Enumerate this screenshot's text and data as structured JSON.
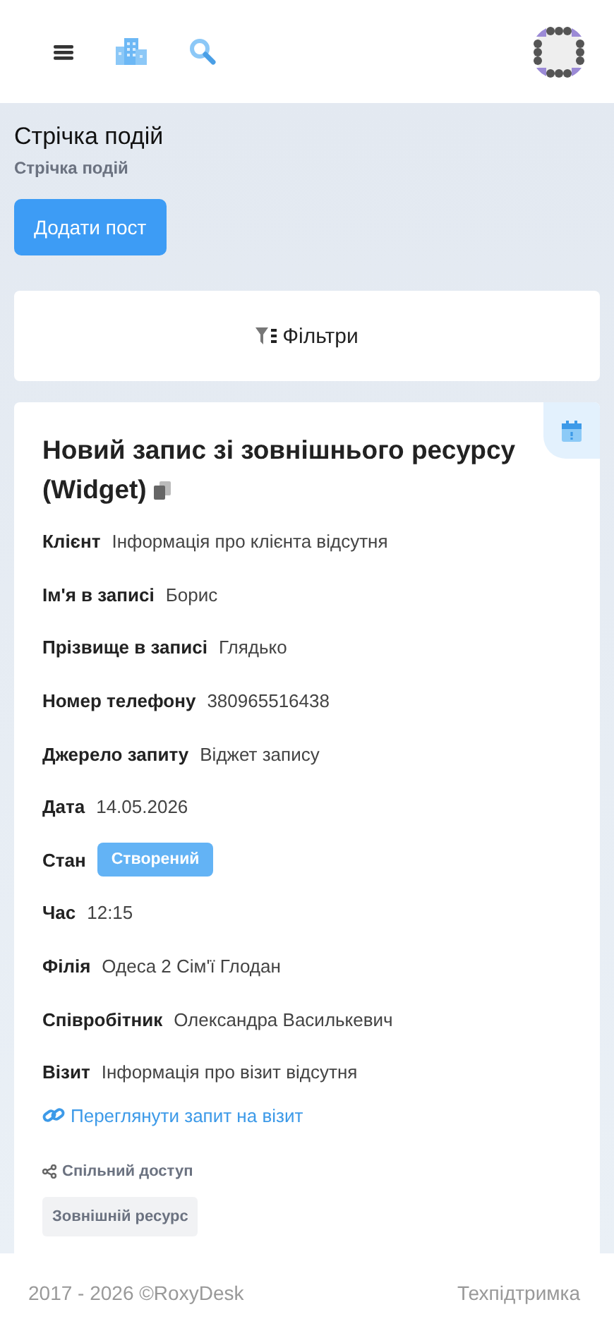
{
  "page_header": {
    "title": "Стрічка подій",
    "breadcrumb": "Стрічка подій"
  },
  "add_button": "Додати пост",
  "filters": {
    "label": "Фільтри"
  },
  "event": {
    "title": "Новий запис зі зовнішнього ресурсу (Widget)",
    "fields": [
      {
        "kind": "text",
        "label": "Клієнт",
        "value": "Інформація про клієнта відсутня"
      },
      {
        "kind": "text",
        "label": "Ім'я в записі",
        "value": "Борис"
      },
      {
        "kind": "text",
        "label": "Прізвище в записі",
        "value": "Глядько"
      },
      {
        "kind": "text",
        "label": "Номер телефону",
        "value": "380965516438"
      },
      {
        "kind": "text",
        "label": "Джерело запиту",
        "value": "Віджет запису"
      },
      {
        "kind": "text",
        "label": "Дата",
        "value": "14.05.2026"
      },
      {
        "kind": "status",
        "label": "Стан",
        "value": "Створений",
        "color": "#63b3f5"
      },
      {
        "kind": "text",
        "label": "Час",
        "value": "12:15"
      },
      {
        "kind": "text",
        "label": "Філія",
        "value": "Одеса 2 Сім'ї Глодан"
      },
      {
        "kind": "text",
        "label": "Співробітник",
        "value": "Олександра Василькевич"
      },
      {
        "kind": "text",
        "label": "Візит",
        "value": "Інформація про візит відсутня"
      }
    ],
    "link": "Переглянути запит на візит",
    "sharing_label": "Спільний доступ",
    "tags": [
      "Зовнішній ресурс"
    ]
  },
  "footer": {
    "copyright": "2017 - 2026 ©RoxyDesk",
    "support_link": "Техпідтримка"
  }
}
